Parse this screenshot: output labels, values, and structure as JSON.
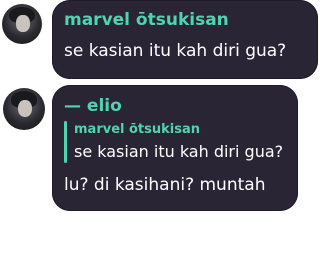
{
  "messages": [
    {
      "author": "marvel ōtsukisan",
      "text": "se kasian itu kah diri gua?"
    },
    {
      "author": "— elio",
      "reply": {
        "author": "marvel ōtsukisan",
        "text": "se kasian itu kah diri gua?"
      },
      "text": "lu? di kasihani? muntah"
    }
  ],
  "colors": {
    "bubble": "#2a2535",
    "author": "#4fd4b0",
    "text": "#ffffff"
  }
}
